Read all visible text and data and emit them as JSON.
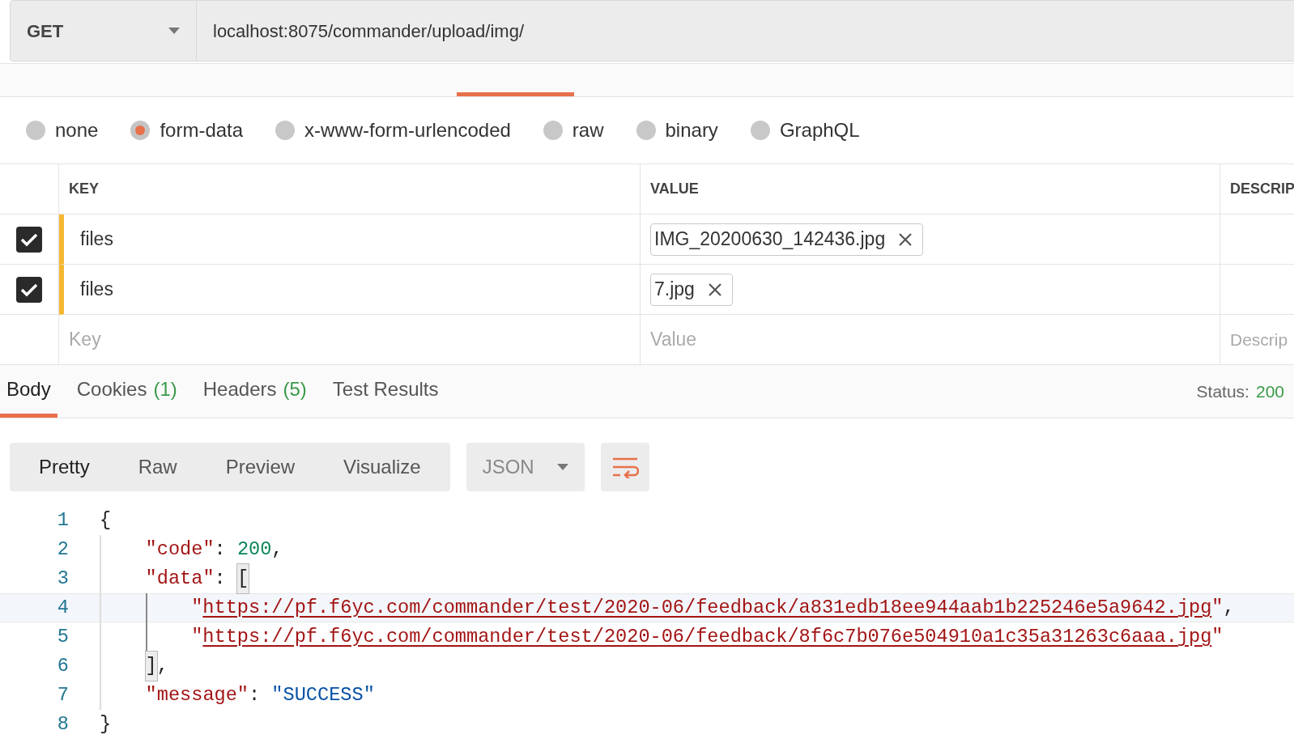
{
  "request": {
    "method": "GET",
    "url": "localhost:8075/commander/upload/img/"
  },
  "body_types": [
    {
      "label": "none",
      "selected": false
    },
    {
      "label": "form-data",
      "selected": true
    },
    {
      "label": "x-www-form-urlencoded",
      "selected": false
    },
    {
      "label": "raw",
      "selected": false
    },
    {
      "label": "binary",
      "selected": false
    },
    {
      "label": "GraphQL",
      "selected": false
    }
  ],
  "params": {
    "columns": [
      "KEY",
      "VALUE",
      "DESCRIP"
    ],
    "rows": [
      {
        "checked": true,
        "key": "files",
        "file": "IMG_20200630_142436.jpg"
      },
      {
        "checked": true,
        "key": "files",
        "file": "7.jpg"
      }
    ],
    "new_row": {
      "key_placeholder": "Key",
      "value_placeholder": "Value",
      "description_placeholder": "Descrip"
    }
  },
  "response_tabs": [
    {
      "label": "Body",
      "selected": true
    },
    {
      "label": "Cookies",
      "count": "(1)",
      "selected": false
    },
    {
      "label": "Headers",
      "count": "(5)",
      "selected": false
    },
    {
      "label": "Test Results",
      "selected": false
    }
  ],
  "status": {
    "label": "Status:",
    "value": "200"
  },
  "view_modes": [
    {
      "label": "Pretty",
      "selected": true
    },
    {
      "label": "Raw",
      "selected": false
    },
    {
      "label": "Preview",
      "selected": false
    },
    {
      "label": "Visualize",
      "selected": false
    }
  ],
  "format": "JSON",
  "code": [
    {
      "number": "1",
      "active": false,
      "tokens": [
        {
          "kind": "open",
          "text": "{"
        }
      ]
    },
    {
      "number": "2",
      "active": false,
      "tokens": [
        {
          "kind": "key",
          "text": "\"code\""
        },
        {
          "kind": "punct",
          "text": ": "
        },
        {
          "kind": "number",
          "text": "200"
        },
        {
          "kind": "punct",
          "text": ","
        }
      ]
    },
    {
      "number": "3",
      "active": false,
      "tokens": [
        {
          "kind": "key",
          "text": "\"data\""
        },
        {
          "kind": "punct",
          "text": ": "
        },
        {
          "kind": "open",
          "text": "[",
          "matched": true
        }
      ]
    },
    {
      "number": "4",
      "active": true,
      "tokens": [
        {
          "kind": "link",
          "text": "\"https://pf.f6yc.com/commander/test/2020-06/feedback/a831edb18ee944aab1b225246e5a9642.jpg\""
        },
        {
          "kind": "punct",
          "text": ","
        }
      ]
    },
    {
      "number": "5",
      "active": false,
      "tokens": [
        {
          "kind": "link",
          "text": "\"https://pf.f6yc.com/commander/test/2020-06/feedback/8f6c7b076e504910a1c35a31263c6aaa.jpg\""
        }
      ]
    },
    {
      "number": "6",
      "active": false,
      "tokens": [
        {
          "kind": "close",
          "text": "]",
          "matched": true
        },
        {
          "kind": "punct",
          "text": ","
        }
      ]
    },
    {
      "number": "7",
      "active": false,
      "tokens": [
        {
          "kind": "key",
          "text": "\"message\""
        },
        {
          "kind": "punct",
          "text": ": "
        },
        {
          "kind": "string",
          "text": "\"SUCCESS\""
        }
      ]
    },
    {
      "number": "8",
      "active": false,
      "tokens": [
        {
          "kind": "close",
          "text": "}"
        }
      ]
    }
  ]
}
